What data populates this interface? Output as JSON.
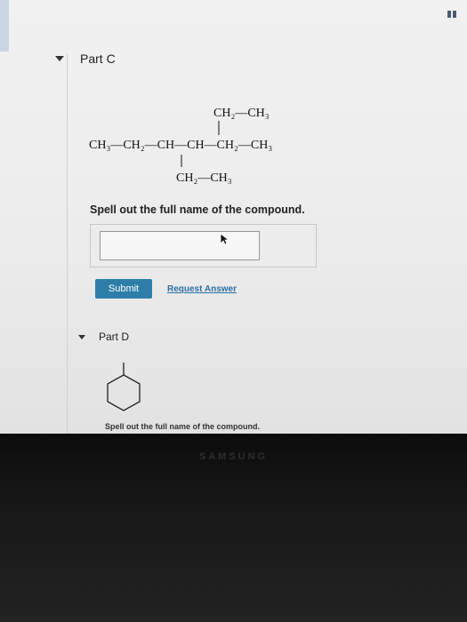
{
  "partC": {
    "label": "Part C",
    "structure": {
      "top_branch": "CH₂—CH₃",
      "main_chain": "CH₃—CH₂—CH—CH—CH₂—CH₃",
      "bottom_branch": "CH₂—CH₃"
    },
    "question": "Spell out the full name of the compound.",
    "answer_value": "",
    "submit_label": "Submit",
    "request_label": "Request Answer"
  },
  "partD": {
    "label": "Part D",
    "question": "Spell out the full name of the compound."
  },
  "bezel": {
    "brand": "SAMSUNG"
  },
  "colors": {
    "submit_bg": "#2d7fa8",
    "link": "#2a6fa5"
  }
}
